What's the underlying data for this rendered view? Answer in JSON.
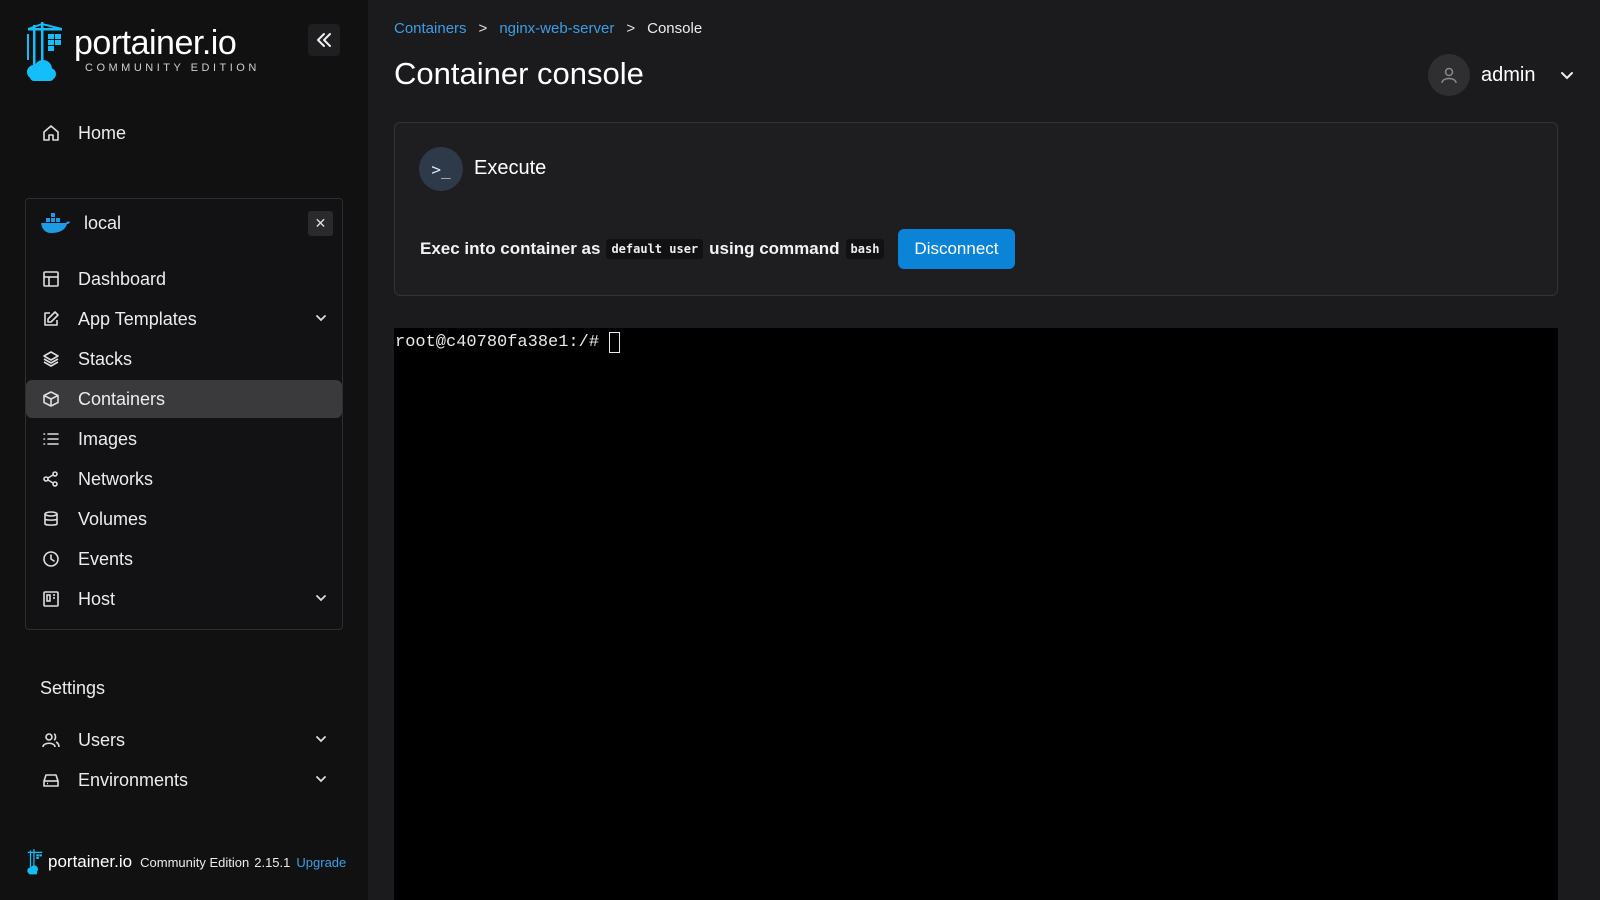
{
  "sidebar": {
    "logo_title": "portainer.io",
    "logo_subtitle": "COMMUNITY EDITION",
    "home_label": "Home",
    "environment_name": "local",
    "env_items": [
      {
        "label": "Dashboard"
      },
      {
        "label": "App Templates"
      },
      {
        "label": "Stacks"
      },
      {
        "label": "Containers"
      },
      {
        "label": "Images"
      },
      {
        "label": "Networks"
      },
      {
        "label": "Volumes"
      },
      {
        "label": "Events"
      },
      {
        "label": "Host"
      }
    ],
    "settings_label": "Settings",
    "settings_items": [
      {
        "label": "Users"
      },
      {
        "label": "Environments"
      }
    ],
    "footer": {
      "brand": "portainer.io",
      "edition": "Community Edition",
      "version": "2.15.1",
      "upgrade": "Upgrade"
    }
  },
  "breadcrumb": {
    "containers": "Containers",
    "sep": ">",
    "container": "nginx-web-server",
    "current": "Console"
  },
  "page_title": "Container console",
  "user": {
    "name": "admin"
  },
  "execute": {
    "title": "Execute",
    "prefix": "Exec into container as",
    "user_code": "default user",
    "middle": "using command",
    "command_code": "bash",
    "disconnect_label": "Disconnect"
  },
  "terminal": {
    "prompt": "root@c40780fa38e1:/#"
  },
  "colors": {
    "accent": "#0b83d6",
    "link": "#3c9ee6",
    "sidebar_bg": "#111112",
    "main_bg": "#1b1b1d",
    "terminal_bg": "#000000"
  }
}
